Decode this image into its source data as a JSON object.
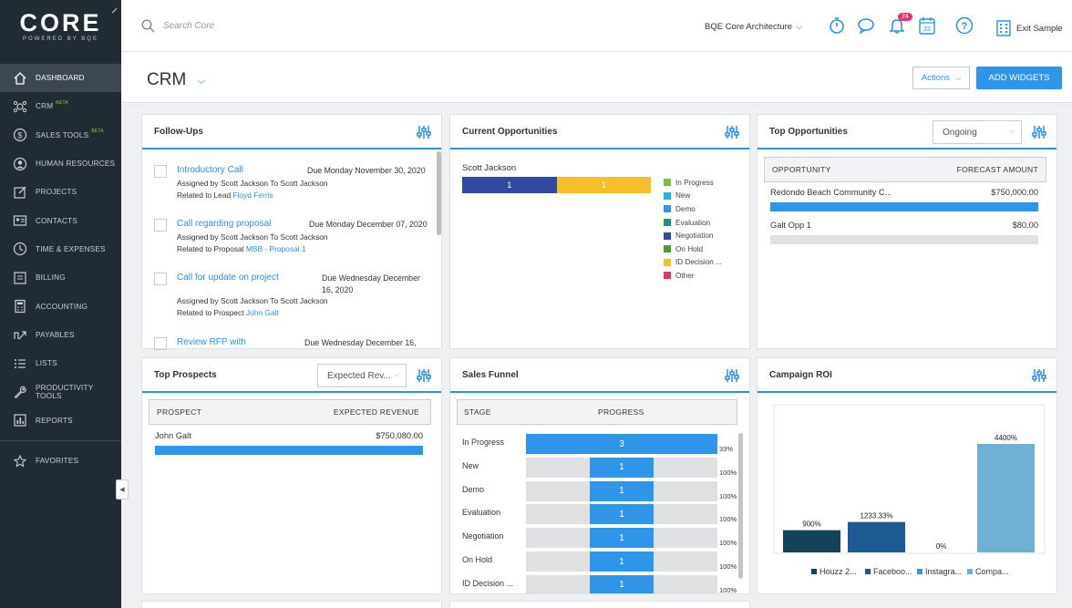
{
  "brand": {
    "logo_text": "CORE",
    "logo_sub": "POWERED BY BQE"
  },
  "sidebar": {
    "items": [
      {
        "label": "DASHBOARD",
        "icon": "home-icon",
        "active": true,
        "beta": ""
      },
      {
        "label": "CRM",
        "icon": "crm-icon",
        "active": false,
        "beta": "BETA"
      },
      {
        "label": "SALES TOOLS",
        "icon": "dollar-icon",
        "active": false,
        "beta": "BETA"
      },
      {
        "label": "HUMAN RESOURCES",
        "icon": "person-icon",
        "active": false,
        "beta": ""
      },
      {
        "label": "PROJECTS",
        "icon": "projects-icon",
        "active": false,
        "beta": ""
      },
      {
        "label": "CONTACTS",
        "icon": "contacts-icon",
        "active": false,
        "beta": ""
      },
      {
        "label": "TIME & EXPENSES",
        "icon": "clock-icon",
        "active": false,
        "beta": ""
      },
      {
        "label": "BILLING",
        "icon": "billing-icon",
        "active": false,
        "beta": ""
      },
      {
        "label": "ACCOUNTING",
        "icon": "calculator-icon",
        "active": false,
        "beta": ""
      },
      {
        "label": "PAYABLES",
        "icon": "payables-icon",
        "active": false,
        "beta": ""
      },
      {
        "label": "LISTS",
        "icon": "list-icon",
        "active": false,
        "beta": ""
      },
      {
        "label": "PRODUCTIVITY TOOLS",
        "icon": "wrench-icon",
        "active": false,
        "beta": ""
      },
      {
        "label": "REPORTS",
        "icon": "reports-icon",
        "active": false,
        "beta": ""
      }
    ],
    "favorites": {
      "label": "FAVORITES",
      "icon": "star-icon"
    }
  },
  "topbar": {
    "search_placeholder": "Search Core",
    "company": "BQE Core Architecture",
    "notifications_count": "24",
    "calendar_day": "23",
    "exit_label": "Exit Sample"
  },
  "page": {
    "title": "CRM",
    "actions_label": "Actions",
    "add_widgets_label": "ADD WIDGETS"
  },
  "followups": {
    "title": "Follow-Ups",
    "items": [
      {
        "title": "Introductory Call",
        "due": "Due Monday November 30, 2020",
        "assigned": "Assigned by Scott Jackson To Scott Jackson",
        "related_prefix": "Related to Lead",
        "related_link": "Floyd Ferris"
      },
      {
        "title": "Call regarding proposal",
        "due": "Due Monday December 07, 2020",
        "assigned": "Assigned by Scott Jackson To Scott Jackson",
        "related_prefix": "Related to Proposal",
        "related_link": "MBB - Proposal 1"
      },
      {
        "title": "Call for update on project",
        "due": "Due Wednesday December 16, 2020",
        "assigned": "Assigned by Scott Jackson To Scott Jackson",
        "related_prefix": "Related to Prospect",
        "related_link": "John Galt"
      },
      {
        "title": "Review RFP with",
        "due": "Due Wednesday December 16,",
        "assigned": "",
        "related_prefix": "",
        "related_link": ""
      }
    ]
  },
  "current_opps": {
    "title": "Current Opportunities",
    "owner": "Scott Jackson",
    "segments": [
      {
        "value": "1",
        "color": "#2f4aa0"
      },
      {
        "value": "1",
        "color": "#f5be2b"
      }
    ],
    "legend": [
      {
        "label": "In Progress",
        "color": "#7cbd41"
      },
      {
        "label": "New",
        "color": "#1fb8d6"
      },
      {
        "label": "Demo",
        "color": "#2f95e8"
      },
      {
        "label": "Evaluation",
        "color": "#149a7a"
      },
      {
        "label": "Negotiation",
        "color": "#2f4aa0"
      },
      {
        "label": "On Hold",
        "color": "#4aa02f"
      },
      {
        "label": "ID Decision ...",
        "color": "#f5be2b"
      },
      {
        "label": "Other",
        "color": "#e8336a"
      }
    ]
  },
  "top_opps": {
    "title": "Top Opportunities",
    "filter": "Ongoing",
    "col1": "OPPORTUNITY",
    "col2": "FORECAST AMOUNT",
    "rows": [
      {
        "name": "Redondo Beach Community C...",
        "amount": "$750,000.00",
        "fill": 1
      },
      {
        "name": "Galt Opp 1",
        "amount": "$80.00",
        "fill": 0
      }
    ]
  },
  "top_prospects": {
    "title": "Top Prospects",
    "filter": "Expected Rev...",
    "col1": "PROSPECT",
    "col2": "EXPECTED REVENUE",
    "rows": [
      {
        "name": "John Galt",
        "amount": "$750,080.00",
        "fill": 1
      }
    ]
  },
  "funnel": {
    "title": "Sales Funnel",
    "col1": "STAGE",
    "col2": "PROGRESS",
    "rows": [
      {
        "stage": "In Progress",
        "value": "3",
        "fill": 1,
        "pct": "33%"
      },
      {
        "stage": "New",
        "value": "1",
        "fill": 0.333,
        "pct": "100%"
      },
      {
        "stage": "Demo",
        "value": "1",
        "fill": 0.333,
        "pct": "100%"
      },
      {
        "stage": "Evaluation",
        "value": "1",
        "fill": 0.333,
        "pct": "100%"
      },
      {
        "stage": "Negotiation",
        "value": "1",
        "fill": 0.333,
        "pct": "100%"
      },
      {
        "stage": "On Hold",
        "value": "1",
        "fill": 0.333,
        "pct": "100%"
      },
      {
        "stage": "ID Decision ...",
        "value": "1",
        "fill": 0.333,
        "pct": "100%"
      }
    ]
  },
  "campaign": {
    "title": "Campaign ROI"
  },
  "chart_data": {
    "type": "bar",
    "title": "Campaign ROI",
    "categories": [
      "Houzz 2...",
      "Faceboo...",
      "Instagra...",
      "Compa..."
    ],
    "values": [
      900,
      1233.33,
      0,
      4400
    ],
    "labels": [
      "900%",
      "1233.33%",
      "0%",
      "4400%"
    ],
    "colors": [
      "#134358",
      "#1d5a92",
      "#2f95e8",
      "#6fb0d4"
    ],
    "legend_position": "bottom"
  }
}
